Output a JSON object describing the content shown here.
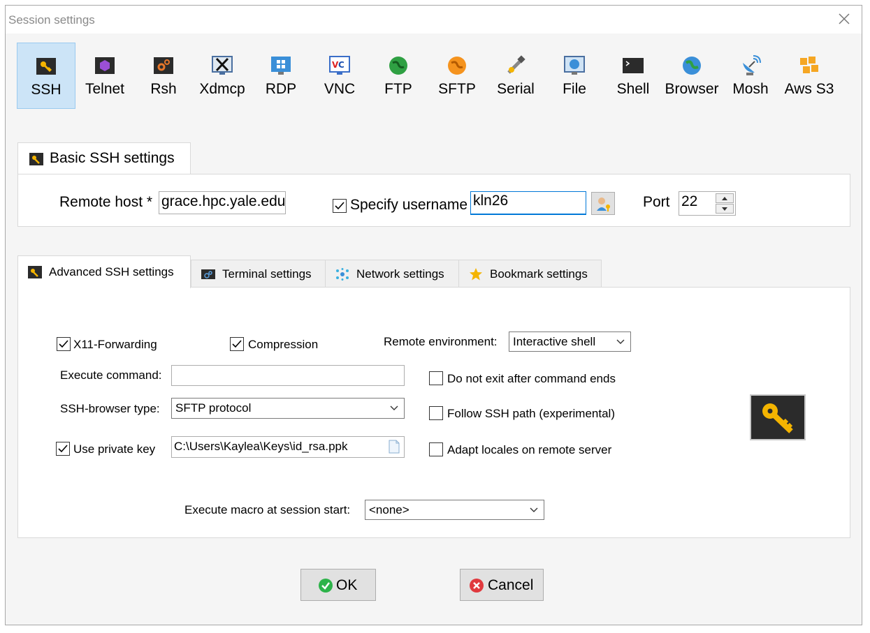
{
  "window": {
    "title": "Session settings"
  },
  "session_types": [
    {
      "label": "SSH",
      "icon": "ssh-key-icon",
      "active": true
    },
    {
      "label": "Telnet",
      "icon": "telnet-icon"
    },
    {
      "label": "Rsh",
      "icon": "rsh-icon"
    },
    {
      "label": "Xdmcp",
      "icon": "xdmcp-icon"
    },
    {
      "label": "RDP",
      "icon": "rdp-icon"
    },
    {
      "label": "VNC",
      "icon": "vnc-icon"
    },
    {
      "label": "FTP",
      "icon": "ftp-globe-icon"
    },
    {
      "label": "SFTP",
      "icon": "sftp-globe-icon"
    },
    {
      "label": "Serial",
      "icon": "serial-plug-icon"
    },
    {
      "label": "File",
      "icon": "file-monitor-icon"
    },
    {
      "label": "Shell",
      "icon": "shell-terminal-icon"
    },
    {
      "label": "Browser",
      "icon": "browser-globe-icon"
    },
    {
      "label": "Mosh",
      "icon": "mosh-satellite-icon"
    },
    {
      "label": "Aws S3",
      "icon": "aws-s3-icon"
    }
  ],
  "basic": {
    "tab_label": "Basic SSH settings",
    "remote_host_label": "Remote host *",
    "remote_host_value": "grace.hpc.yale.edu",
    "specify_username_label": "Specify username",
    "specify_username_checked": true,
    "username_value": "kln26",
    "port_label": "Port",
    "port_value": "22"
  },
  "advanced_tabs": [
    {
      "label": "Advanced SSH settings",
      "active": true
    },
    {
      "label": "Terminal settings"
    },
    {
      "label": "Network settings"
    },
    {
      "label": "Bookmark settings"
    }
  ],
  "advanced": {
    "x11_label": "X11-Forwarding",
    "x11_checked": true,
    "compression_label": "Compression",
    "compression_checked": true,
    "remote_env_label": "Remote environment:",
    "remote_env_value": "Interactive shell",
    "execute_command_label": "Execute command:",
    "execute_command_value": "",
    "do_not_exit_label": "Do not exit after command ends",
    "do_not_exit_checked": false,
    "ssh_browser_label": "SSH-browser type:",
    "ssh_browser_value": "SFTP protocol",
    "follow_ssh_label": "Follow SSH path (experimental)",
    "follow_ssh_checked": false,
    "use_private_key_label": "Use private key",
    "use_private_key_checked": true,
    "private_key_value": "C:\\Users\\Kaylea\\Keys\\id_rsa.ppk",
    "adapt_locales_label": "Adapt locales on remote server",
    "adapt_locales_checked": false,
    "macro_label": "Execute macro at session start:",
    "macro_value": "<none>"
  },
  "buttons": {
    "ok": "OK",
    "cancel": "Cancel"
  },
  "colors": {
    "accent_selected": "#cce4f7",
    "key_yellow": "#f4b400",
    "ok_green": "#2db34a",
    "cancel_red": "#e0393e"
  }
}
